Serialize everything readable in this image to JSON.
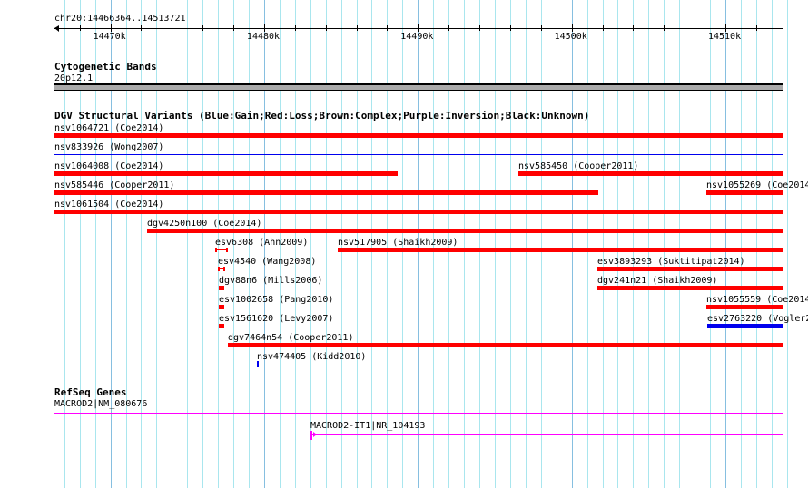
{
  "ruler": {
    "label": "chr20:14466364..14513721",
    "view_start": 14466364,
    "view_end": 14513721,
    "major_ticks": [
      {
        "pos": 14470000,
        "label": "14470k"
      },
      {
        "pos": 14480000,
        "label": "14480k"
      },
      {
        "pos": 14490000,
        "label": "14490k"
      },
      {
        "pos": 14500000,
        "label": "14500k"
      },
      {
        "pos": 14510000,
        "label": "14510k"
      }
    ]
  },
  "cyto": {
    "title": "Cytogenetic Bands",
    "band": "20p12.1",
    "band_color": "#aaaaaa"
  },
  "dgv": {
    "title": "DGV Structural Variants (Blue:Gain;Red:Loss;Brown:Complex;Purple:Inversion;Black:Unknown)",
    "colors": {
      "loss": "#ff0000",
      "gain": "#0000ee"
    },
    "rows": [
      [
        {
          "label": "nsv1064721 (Coe2014)",
          "start": 14466364,
          "end": 14513721,
          "type": "loss"
        }
      ],
      [
        {
          "label": "nsv833926 (Wong2007)",
          "start": 14466364,
          "end": 14513721,
          "type": "gain",
          "thin": true
        }
      ],
      [
        {
          "label": "nsv1064008 (Coe2014)",
          "start": 14466364,
          "end": 14488680,
          "type": "loss"
        },
        {
          "label": "nsv585450 (Cooper2011)",
          "start": 14496540,
          "end": 14513721,
          "type": "loss"
        }
      ],
      [
        {
          "label": "nsv585446 (Cooper2011)",
          "start": 14466364,
          "end": 14501740,
          "type": "loss"
        },
        {
          "label": "nsv1055269 (Coe2014)",
          "start": 14508760,
          "end": 14513721,
          "type": "loss"
        }
      ],
      [
        {
          "label": "nsv1061504 (Coe2014)",
          "start": 14466364,
          "end": 14513721,
          "type": "loss"
        }
      ],
      [
        {
          "label": "dgv4250n100 (Coe2014)",
          "start": 14472390,
          "end": 14513721,
          "type": "loss"
        }
      ],
      [
        {
          "label": "esv6308 (Ahn2009)",
          "start": 14476820,
          "end": 14477640,
          "type": "loss",
          "capped": true
        },
        {
          "label": "nsv517905 (Shaikh2009)",
          "start": 14484790,
          "end": 14513721,
          "type": "loss"
        }
      ],
      [
        {
          "label": "esv4540 (Wang2008)",
          "start": 14476990,
          "end": 14477470,
          "type": "loss",
          "capped": true
        },
        {
          "label": "esv3893293 (Suktitipat2014)",
          "start": 14501680,
          "end": 14513721,
          "type": "loss"
        }
      ],
      [
        {
          "label": "dgv88n6 (Mills2006)",
          "start": 14477050,
          "end": 14477400,
          "type": "loss"
        },
        {
          "label": "dgv241n21 (Shaikh2009)",
          "start": 14501680,
          "end": 14513721,
          "type": "loss"
        }
      ],
      [
        {
          "label": "esv1002658 (Pang2010)",
          "start": 14477050,
          "end": 14477400,
          "type": "loss"
        },
        {
          "label": "nsv1055559 (Coe2014)",
          "start": 14508760,
          "end": 14513721,
          "type": "loss"
        }
      ],
      [
        {
          "label": "esv1561620 (Levy2007)",
          "start": 14477050,
          "end": 14477400,
          "type": "loss"
        },
        {
          "label": "esv2763220 (Vogler2",
          "start": 14508820,
          "end": 14513721,
          "type": "gain"
        }
      ],
      [
        {
          "label": "dgv7464n54 (Cooper2011)",
          "start": 14477640,
          "end": 14513721,
          "type": "loss"
        }
      ],
      [
        {
          "label": "nsv474405 (Kidd2010)",
          "start": 14479530,
          "end": 14479650,
          "type": "gain",
          "narrow": true
        }
      ]
    ]
  },
  "refseq": {
    "title": "RefSeq Genes",
    "color": "#ff00ff",
    "genes": [
      {
        "label": "MACROD2|NM_080676",
        "start": 14466364,
        "end": 14513721
      },
      {
        "label": "MACROD2-IT1|NR_104193",
        "start": 14483010,
        "end": 14513721,
        "tss": true
      }
    ]
  }
}
